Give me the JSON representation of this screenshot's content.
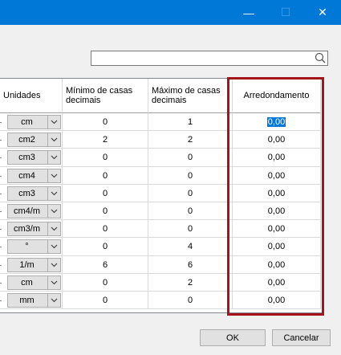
{
  "titlebar": {
    "minimize": "—",
    "maximize": "☐",
    "close": "✕"
  },
  "search": {
    "value": ""
  },
  "table": {
    "headers": {
      "unidades": "Unidades",
      "minimo": "Mínimo de casas decimais",
      "maximo": "Máximo de casas decimais",
      "arredondamento": "Arredondamento"
    },
    "rows": [
      {
        "unit": "cm",
        "min": "0",
        "max": "1",
        "round": "0,00"
      },
      {
        "unit": "cm2",
        "min": "2",
        "max": "2",
        "round": "0,00"
      },
      {
        "unit": "cm3",
        "min": "0",
        "max": "0",
        "round": "0,00"
      },
      {
        "unit": "cm4",
        "min": "0",
        "max": "0",
        "round": "0,00"
      },
      {
        "unit": "cm3",
        "min": "0",
        "max": "0",
        "round": "0,00"
      },
      {
        "unit": "cm4/m",
        "min": "0",
        "max": "0",
        "round": "0,00"
      },
      {
        "unit": "cm3/m",
        "min": "0",
        "max": "0",
        "round": "0,00"
      },
      {
        "unit": "°",
        "min": "0",
        "max": "4",
        "round": "0,00"
      },
      {
        "unit": "1/m",
        "min": "6",
        "max": "6",
        "round": "0,00"
      },
      {
        "unit": "cm",
        "min": "0",
        "max": "2",
        "round": "0,00"
      },
      {
        "unit": "mm",
        "min": "0",
        "max": "0",
        "round": "0,00"
      }
    ]
  },
  "buttons": {
    "ok": "OK",
    "cancel": "Cancelar"
  },
  "colors": {
    "titlebar": "#0078d7",
    "highlight": "#a4151b",
    "selection": "#0078d7"
  }
}
